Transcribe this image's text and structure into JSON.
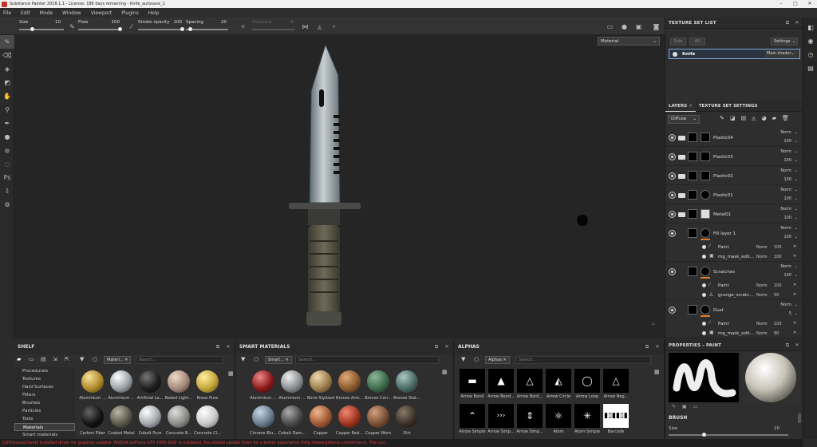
{
  "titlebar": {
    "title": "Substance Painter 2018.1.1 - License: 186 days remaining - Knife_autosave_1"
  },
  "menubar": {
    "items": [
      "File",
      "Edit",
      "Mode",
      "Window",
      "Viewport",
      "Plugins",
      "Help"
    ]
  },
  "toolbar": {
    "size_label": "Size",
    "size_value": "10",
    "flow_label": "Flow",
    "flow_value": "100",
    "stroke_label": "Stroke opacity",
    "stroke_value": "100",
    "spacing_label": "Spacing",
    "spacing_value": "20",
    "distance_label": "Distance",
    "distance_value": "8"
  },
  "viewport": {
    "mode": "Material"
  },
  "texture_set_list": {
    "title": "TEXTURE SET LIST",
    "solo_label": "Solo",
    "all_label": "All",
    "settings_label": "Settings",
    "set_name": "Knife",
    "shader": "Main shader"
  },
  "layers": {
    "tab_layers": "LAYERS",
    "tab_texture_settings": "TEXTURE SET SETTINGS",
    "channel": "Diffuse",
    "items": [
      {
        "name": "Plastic04",
        "mode": "Norm",
        "opacity": "100"
      },
      {
        "name": "Plastic03",
        "mode": "Norm",
        "opacity": "100"
      },
      {
        "name": "Plastic02",
        "mode": "Norm",
        "opacity": "100"
      },
      {
        "name": "Plastic01",
        "mode": "Norm",
        "opacity": "100"
      },
      {
        "name": "Metal01",
        "mode": "Norm",
        "opacity": "100"
      },
      {
        "name": "Fill layer 1",
        "mode": "Norm",
        "opacity": "100"
      },
      {
        "name": "Scratches",
        "mode": "Norm",
        "opacity": "100"
      },
      {
        "name": "Dust",
        "mode": "Norm",
        "opacity": "5"
      }
    ],
    "effects": [
      {
        "name": "Paint",
        "mode": "Norm",
        "opacity": "100"
      },
      {
        "name": "mg_mask_edit...",
        "mode": "Norm",
        "opacity": "100"
      },
      {
        "name": "Paint",
        "mode": "Norm",
        "opacity": "100"
      },
      {
        "name": "grunge_scratc...",
        "mode": "Norm",
        "opacity": "50"
      },
      {
        "name": "Paint",
        "mode": "Norm",
        "opacity": "100"
      },
      {
        "name": "mg_mask_edit...",
        "mode": "Norm",
        "opacity": "80"
      }
    ]
  },
  "shelf": {
    "title": "SHELF",
    "chip": "Materi...",
    "search_placeholder": "Search...",
    "categories": [
      "Procedurals",
      "Textures",
      "Hard Surfaces",
      "Filters",
      "Brushes",
      "Particles",
      "Tools",
      "Materials",
      "Smart materials"
    ],
    "items_row1": [
      "Aluminium ...",
      "Aluminium ...",
      "Artificial Le...",
      "Baked Light...",
      "Brass Pure"
    ],
    "items_row2": [
      "Carbon Fiber",
      "Coated Metal",
      "Cobalt Pure",
      "Concrete B...",
      "Concrete Cl..."
    ]
  },
  "smart_materials": {
    "title": "SMART MATERIALS",
    "chip": "Smart...",
    "search_placeholder": "Search...",
    "items_row1": [
      "Aluminium ...",
      "Aluminium ...",
      "Bone Stylized",
      "Bronze Arm...",
      "Bronze Corr...",
      "Bronze Stat..."
    ],
    "items_row2": [
      "Chrome Blu...",
      "Cobalt Dam...",
      "Copper",
      "Copper Red...",
      "Copper Worn",
      "Dirt"
    ]
  },
  "alphas": {
    "title": "ALPHAS",
    "chip": "Alphas",
    "search_placeholder": "Search...",
    "items_row1": [
      "Arrow Band",
      "Arrow Bend...",
      "Arrow Bord...",
      "Arrow Circle",
      "Arrow Loop",
      "Arrow Neg..."
    ],
    "items_row2": [
      "Arrow Simple",
      "Arrow Simp...",
      "Arrow Simp...",
      "Atom",
      "Atom Simple",
      "Barcode"
    ]
  },
  "properties": {
    "title": "PROPERTIES - PAINT",
    "brush_label": "BRUSH",
    "size_label": "Size",
    "size_value": "10"
  },
  "statusbar": {
    "message": "[GPUIssuesCheck] Installed driver for graphics adapter 'NVIDIA GeForce GTX 1060 6GB' is outdated. You should update them for a better experience (http://www.geforce.com/drivers). The curr..."
  },
  "colors": {
    "accent": "#e37b2b",
    "status_error": "#e04040",
    "background": "#2b2b2b"
  }
}
